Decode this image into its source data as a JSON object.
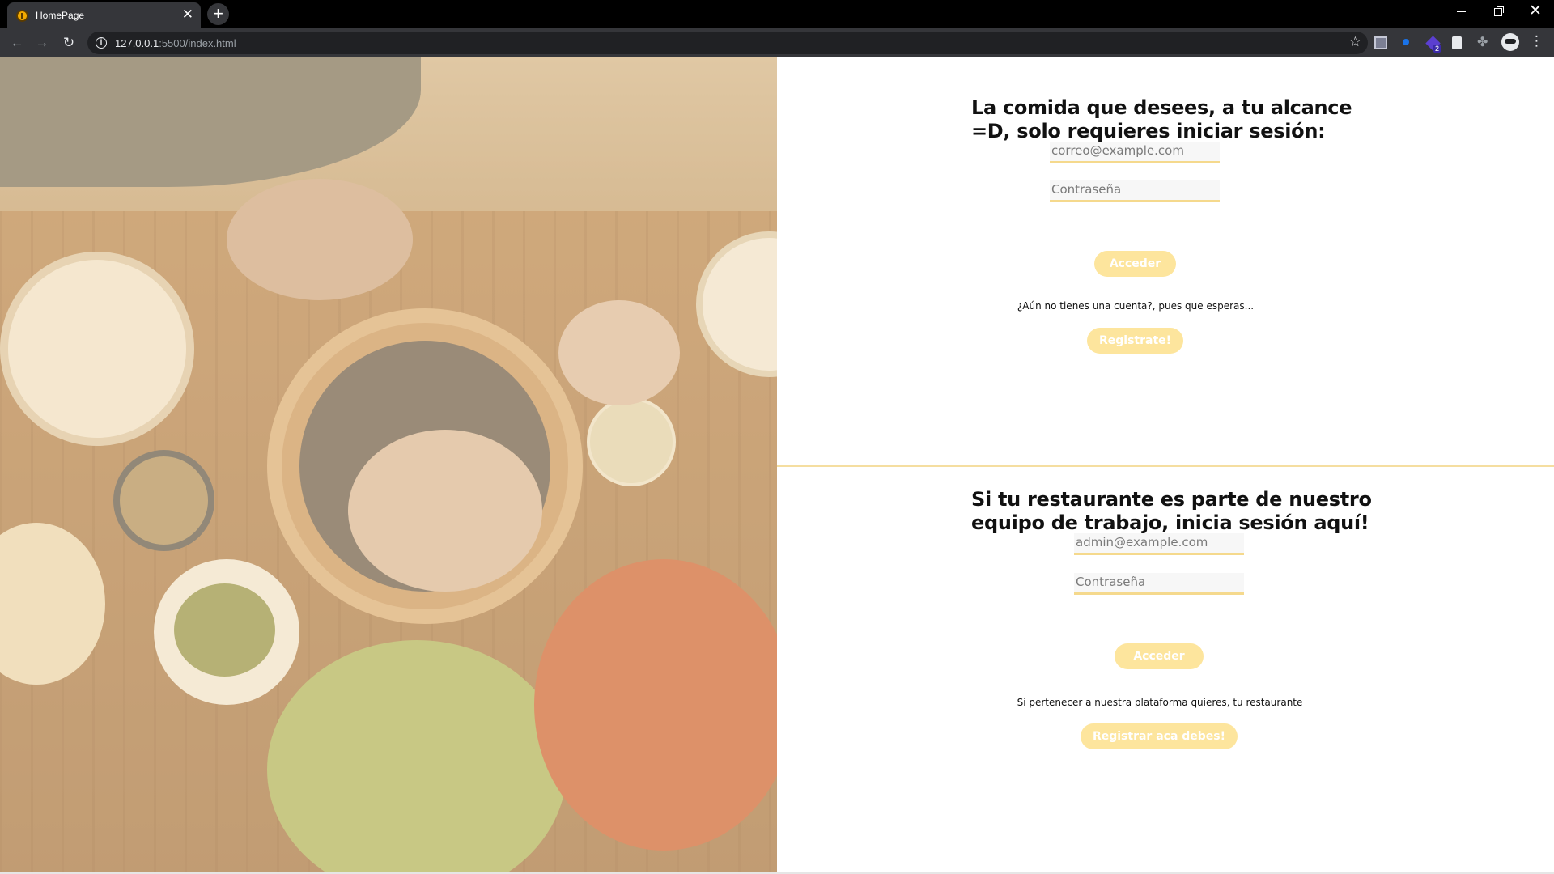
{
  "browser": {
    "tab_title": "HomePage",
    "url_host": "127.0.0.1",
    "url_rest": ":5500/index.html",
    "extension_badge": "2"
  },
  "user_login": {
    "heading": "La comida que desees, a tu alcance =D, solo requieres iniciar sesión:",
    "email_placeholder": "correo@example.com",
    "password_placeholder": "Contraseña",
    "submit_label": "Acceder",
    "register_prompt": "¿Aún no tienes una cuenta?, pues que esperas...",
    "register_label": "Registrate!"
  },
  "restaurant_login": {
    "heading": "Si tu restaurante es parte de nuestro equipo de trabajo, inicia sesión aquí!",
    "email_placeholder": "admin@example.com",
    "password_placeholder": "Contraseña",
    "submit_label": "Acceder",
    "register_prompt": "Si pertenecer a nuestra plataforma quieres, tu restaurante",
    "register_label": "Registrar aca debes!"
  },
  "colors": {
    "accent": "#fde59d",
    "field_underline": "#f5d98d"
  }
}
